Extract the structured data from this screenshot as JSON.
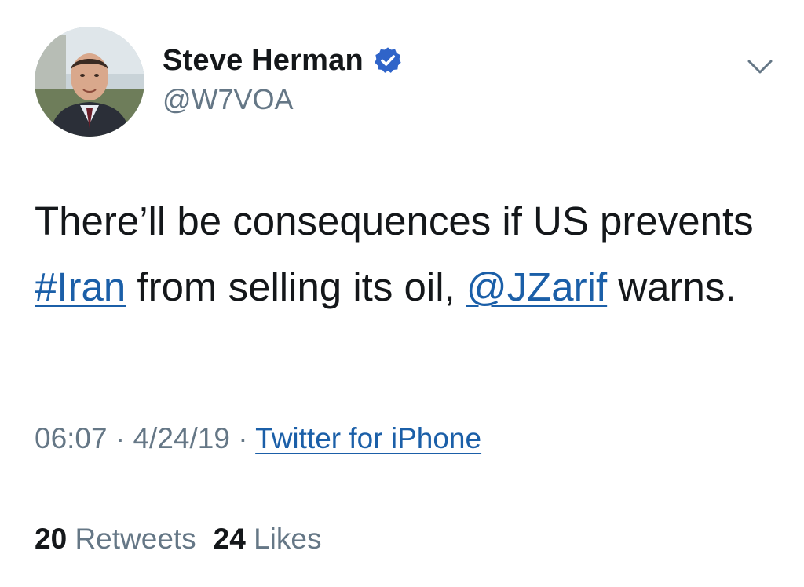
{
  "author": {
    "display_name": "Steve Herman",
    "handle": "@W7VOA",
    "verified": true,
    "avatar_icon": "profile-photo"
  },
  "menu": {
    "icon": "chevron-down-icon"
  },
  "tweet": {
    "text_part1": "There’ll be consequences if US prevents ",
    "hashtag": "#Iran",
    "text_part2": " from selling its oil, ",
    "mention": "@JZarif",
    "text_part3": " warns."
  },
  "meta": {
    "time": "06:07",
    "separator1": " · ",
    "date": "4/24/19",
    "separator2": " · ",
    "source": "Twitter for iPhone"
  },
  "stats": {
    "retweets_count": "20",
    "retweets_label": "Retweets",
    "likes_count": "24",
    "likes_label": "Likes"
  },
  "colors": {
    "link": "#1b5fa8",
    "secondary_text": "#657786",
    "verified_badge": "#2f64c9"
  }
}
